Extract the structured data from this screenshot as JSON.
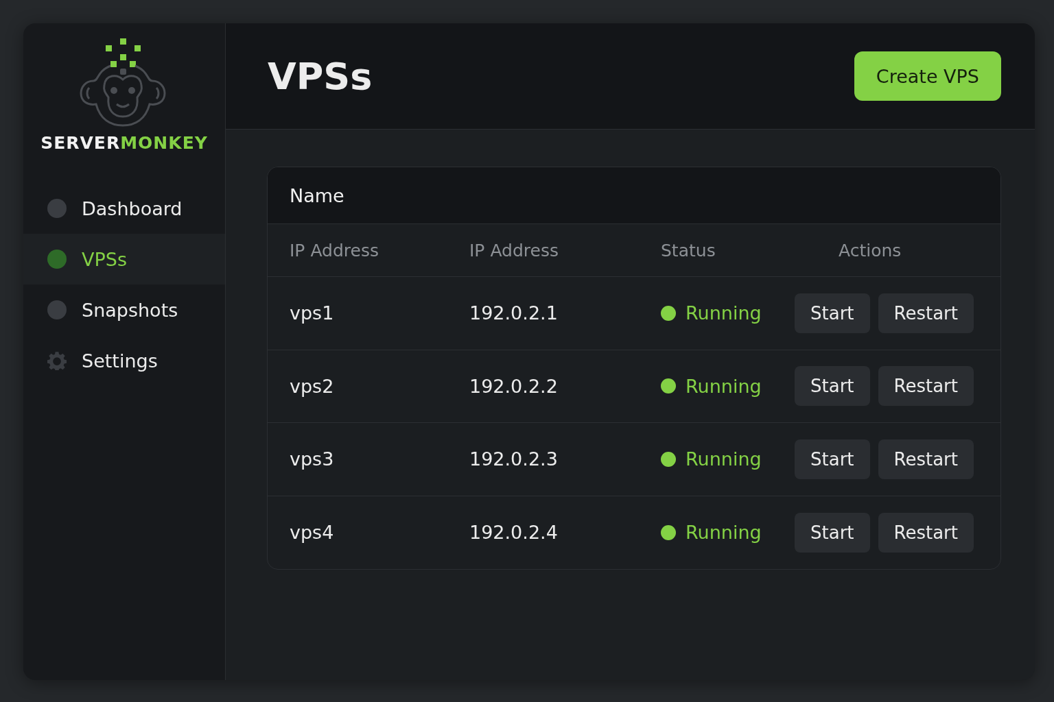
{
  "brand": {
    "primary": "SERVER",
    "accent": "MONKEY"
  },
  "sidebar": {
    "items": [
      {
        "label": "Dashboard",
        "kind": "dot",
        "selected": false
      },
      {
        "label": "VPSs",
        "kind": "dot",
        "selected": true
      },
      {
        "label": "Snapshots",
        "kind": "dot",
        "selected": false
      },
      {
        "label": "Settings",
        "kind": "gear",
        "selected": false
      }
    ]
  },
  "header": {
    "title": "VPSs",
    "action": "Create VPS"
  },
  "table": {
    "title": "Name",
    "columns": [
      "IP Address",
      "IP Address",
      "Status",
      "Actions"
    ],
    "rows": [
      {
        "name": "vps1",
        "ip": "192.0.2.1",
        "status": "Running",
        "color": "#84d145",
        "actions": [
          "Start",
          "Restart"
        ]
      },
      {
        "name": "vps2",
        "ip": "192.0.2.2",
        "status": "Running",
        "color": "#84d145",
        "actions": [
          "Start",
          "Restart"
        ]
      },
      {
        "name": "vps3",
        "ip": "192.0.2.3",
        "status": "Running",
        "color": "#84d145",
        "actions": [
          "Start",
          "Restart"
        ]
      },
      {
        "name": "vps4",
        "ip": "192.0.2.4",
        "status": "Running",
        "color": "#84d145",
        "actions": [
          "Start",
          "Restart"
        ]
      }
    ]
  }
}
